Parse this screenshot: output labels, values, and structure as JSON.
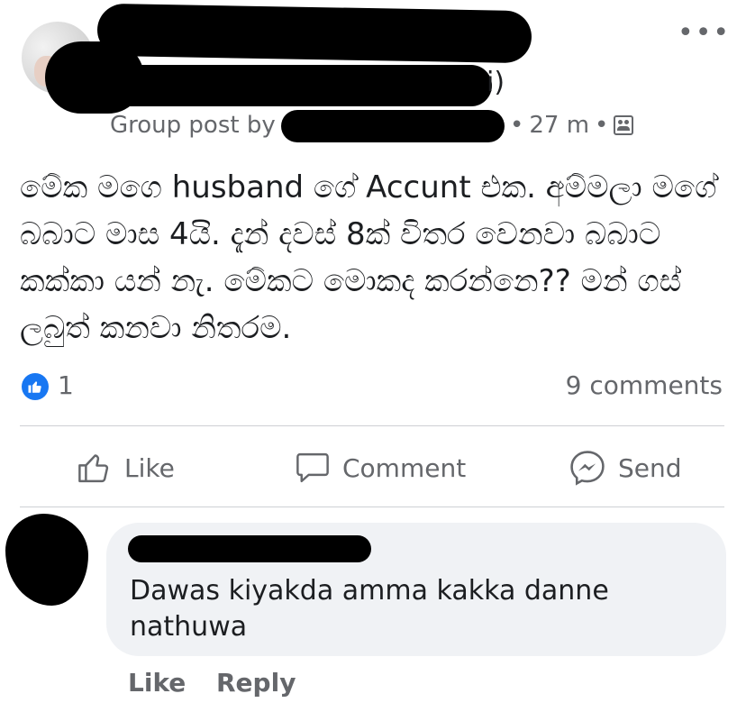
{
  "post": {
    "group_post_label": "Group post by",
    "name_tail": "i)",
    "time": "27 m",
    "separator": "•",
    "body": "මේක මගෙ husband ගේ Accunt එක. අම්මලා මගේ බබාට මාස 4යි. දැන් දවස් 8ක් විතර වෙනවා බබාට කක්කා යන් නැ. මේකට මොකද කරන්නෙ?? මන් ගස් ලබුත් කනවා නිතරම.",
    "more_label": "•••"
  },
  "reactions": {
    "count": "1",
    "comments": "9 comments"
  },
  "actions": {
    "like": "Like",
    "comment": "Comment",
    "send": "Send"
  },
  "comment": {
    "text": "Dawas kiyakda amma kakka danne nathuwa",
    "like": "Like",
    "reply": "Reply"
  },
  "colors": {
    "accent": "#1877f2",
    "secondary_text": "#65676b",
    "bubble": "#f0f2f5"
  }
}
